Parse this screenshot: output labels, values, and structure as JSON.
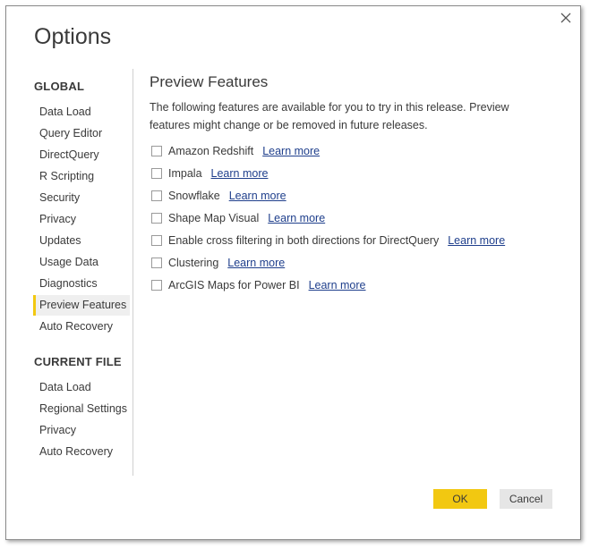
{
  "dialog": {
    "title": "Options",
    "close_icon": "close-icon"
  },
  "sidebar": {
    "global_header": "GLOBAL",
    "global_items": [
      {
        "label": "Data Load"
      },
      {
        "label": "Query Editor"
      },
      {
        "label": "DirectQuery"
      },
      {
        "label": "R Scripting"
      },
      {
        "label": "Security"
      },
      {
        "label": "Privacy"
      },
      {
        "label": "Updates"
      },
      {
        "label": "Usage Data"
      },
      {
        "label": "Diagnostics"
      },
      {
        "label": "Preview Features",
        "selected": true
      },
      {
        "label": "Auto Recovery"
      }
    ],
    "current_header": "CURRENT FILE",
    "current_items": [
      {
        "label": "Data Load"
      },
      {
        "label": "Regional Settings"
      },
      {
        "label": "Privacy"
      },
      {
        "label": "Auto Recovery"
      }
    ]
  },
  "content": {
    "title": "Preview Features",
    "description": "The following features are available for you to try in this release. Preview features might change or be removed in future releases.",
    "features": [
      {
        "label": "Amazon Redshift",
        "link": "Learn more",
        "checked": false
      },
      {
        "label": "Impala",
        "link": "Learn more",
        "checked": false
      },
      {
        "label": "Snowflake",
        "link": "Learn more",
        "checked": false
      },
      {
        "label": "Shape Map Visual",
        "link": "Learn more",
        "checked": false
      },
      {
        "label": "Enable cross filtering in both directions for DirectQuery",
        "link": "Learn more",
        "checked": false
      },
      {
        "label": "Clustering",
        "link": "Learn more",
        "checked": false
      },
      {
        "label": "ArcGIS Maps for Power BI",
        "link": "Learn more",
        "checked": false
      }
    ]
  },
  "buttons": {
    "ok_label": "OK",
    "cancel_label": "Cancel"
  },
  "colors": {
    "accent": "#f2c811",
    "link": "#1f3f8c",
    "text": "#3a3a3a"
  }
}
